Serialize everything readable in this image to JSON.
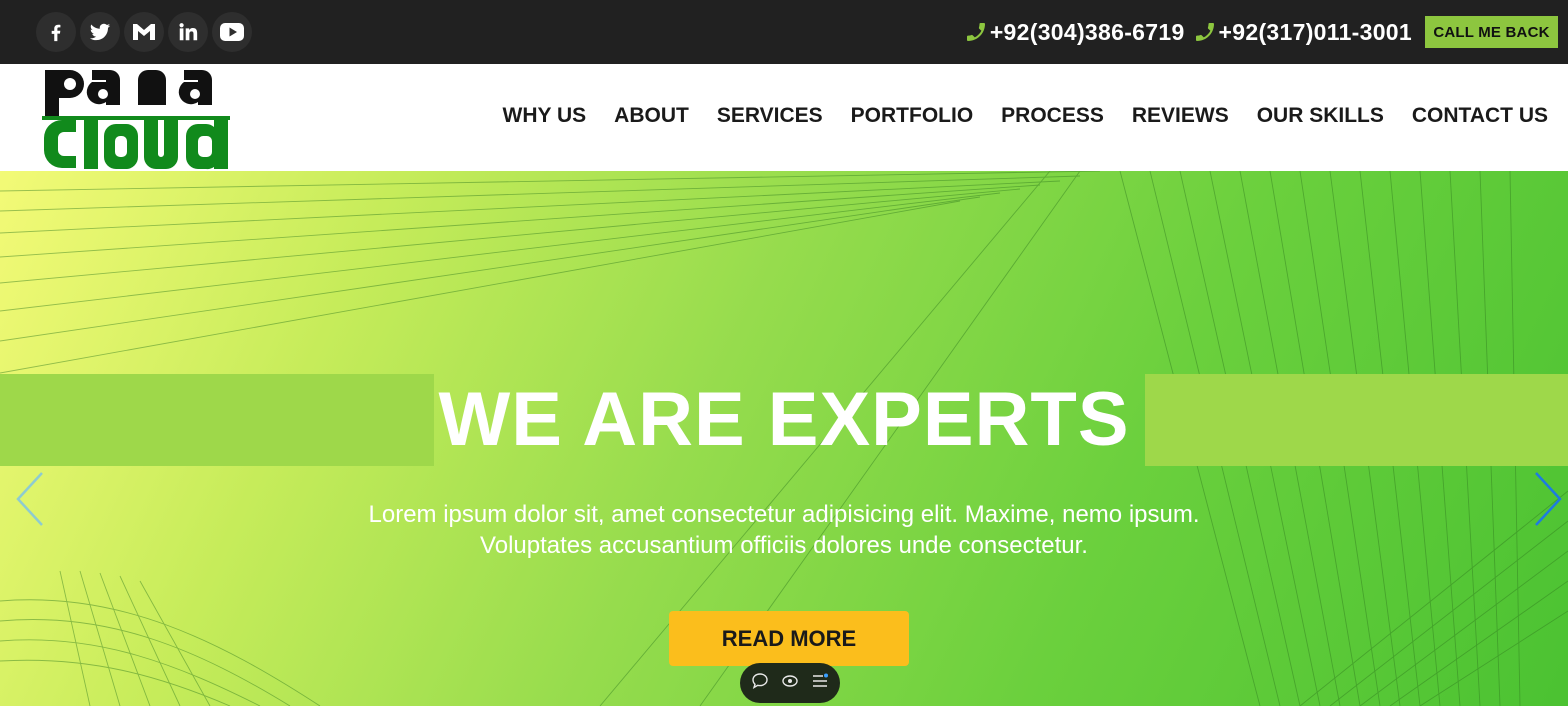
{
  "topbar": {
    "social": [
      {
        "name": "facebook-icon",
        "label": "Facebook"
      },
      {
        "name": "twitter-icon",
        "label": "Twitter"
      },
      {
        "name": "gmail-icon",
        "label": "Gmail"
      },
      {
        "name": "linkedin-icon",
        "label": "LinkedIn"
      },
      {
        "name": "youtube-icon",
        "label": "YouTube"
      }
    ],
    "phone_1": "+92(304)386-6719",
    "phone_2": "+92(317)011-3001",
    "callback_label": "CALL ME BACK",
    "accent_color": "#8dc63f"
  },
  "header": {
    "logo_text": "pana cloud",
    "nav": [
      "WHY US",
      "ABOUT",
      "SERVICES",
      "PORTFOLIO",
      "PROCESS",
      "REVIEWS",
      "OUR SKILLS",
      "CONTACT US"
    ]
  },
  "hero": {
    "title": "WE ARE EXPERTS",
    "text_line_1": "Lorem ipsum dolor sit, amet consectetur adipisicing elit. Maxime, nemo ipsum.",
    "text_line_2": "Voluptates accusantium officiis dolores unde consectetur.",
    "button_label": "READ MORE",
    "button_color": "#fbbe1c",
    "prev_icon": "chevron-left-icon",
    "next_icon": "chevron-right-icon",
    "widget_icons": [
      "chat-icon",
      "eye-icon",
      "menu-icon"
    ]
  }
}
